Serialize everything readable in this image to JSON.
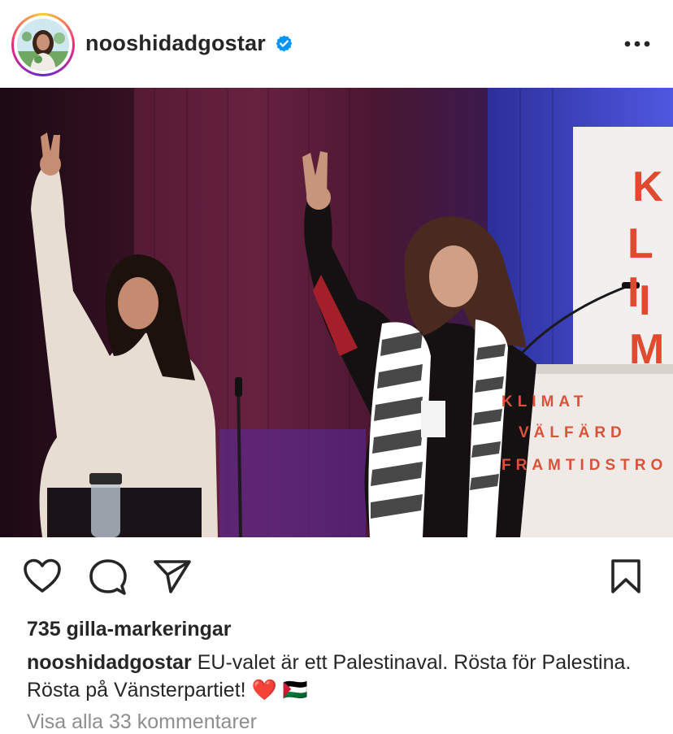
{
  "post": {
    "username": "nooshidadgostar",
    "verified": true,
    "likes_text": "735 gilla-markeringar",
    "caption_user": "nooshidadgostar",
    "caption_text": "EU-valet är ett Palestinaval. Rösta för Palestina. Rösta på Vänsterpartiet! ❤️ 🇵🇸",
    "comments_link": "Visa alla 33 kommentarer"
  },
  "photo": {
    "podium_lines": [
      "KLIMAT",
      "VÄLFÄRD",
      "FRAMTIDSTRO"
    ],
    "banner_letters": [
      "K",
      "L I",
      "I",
      "M"
    ]
  },
  "icons": {
    "more": "more-dots-icon",
    "like": "heart-icon",
    "comment": "comment-icon",
    "share": "send-icon",
    "save": "bookmark-icon",
    "verified": "verified-badge-icon"
  },
  "colors": {
    "verified_blue": "#0095f6",
    "text": "#262626",
    "muted": "#8e8e8e",
    "podium_red": "#d9533a"
  }
}
